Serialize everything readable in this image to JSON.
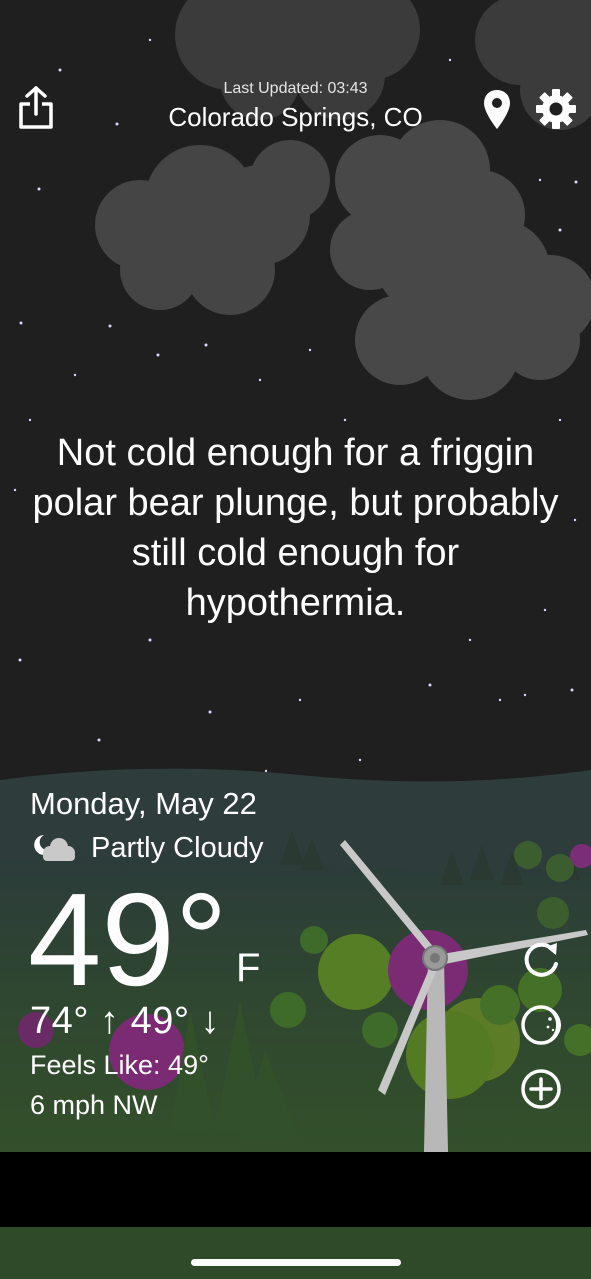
{
  "header": {
    "last_updated": "Last Updated: 03:43",
    "location": "Colorado Springs, CO",
    "share_icon": "share-icon",
    "location_pin_icon": "location-pin-icon",
    "settings_icon": "gear-icon"
  },
  "quote": "Not cold enough for a friggin polar bear plunge, but probably still cold enough for hypothermia.",
  "forecast": {
    "date": "Monday, May 22",
    "condition_icon": "partly-cloudy-night-icon",
    "condition": "Partly Cloudy",
    "temperature": "49°",
    "unit": "F",
    "hi_lo": "74° ↑  49° ↓",
    "feels_like": "Feels Like: 49°",
    "wind": "6 mph NW"
  },
  "actions": {
    "refresh_icon": "refresh-icon",
    "theme_icon": "moon-icon",
    "add_icon": "add-location-icon"
  },
  "colors": {
    "sky": "#202020",
    "hills": "#2f3f3e",
    "grass": "#2f4a28",
    "tree_green": "#4f7f1f",
    "tree_magenta": "#8a2b7a",
    "cloud": "#4a4a4a"
  }
}
